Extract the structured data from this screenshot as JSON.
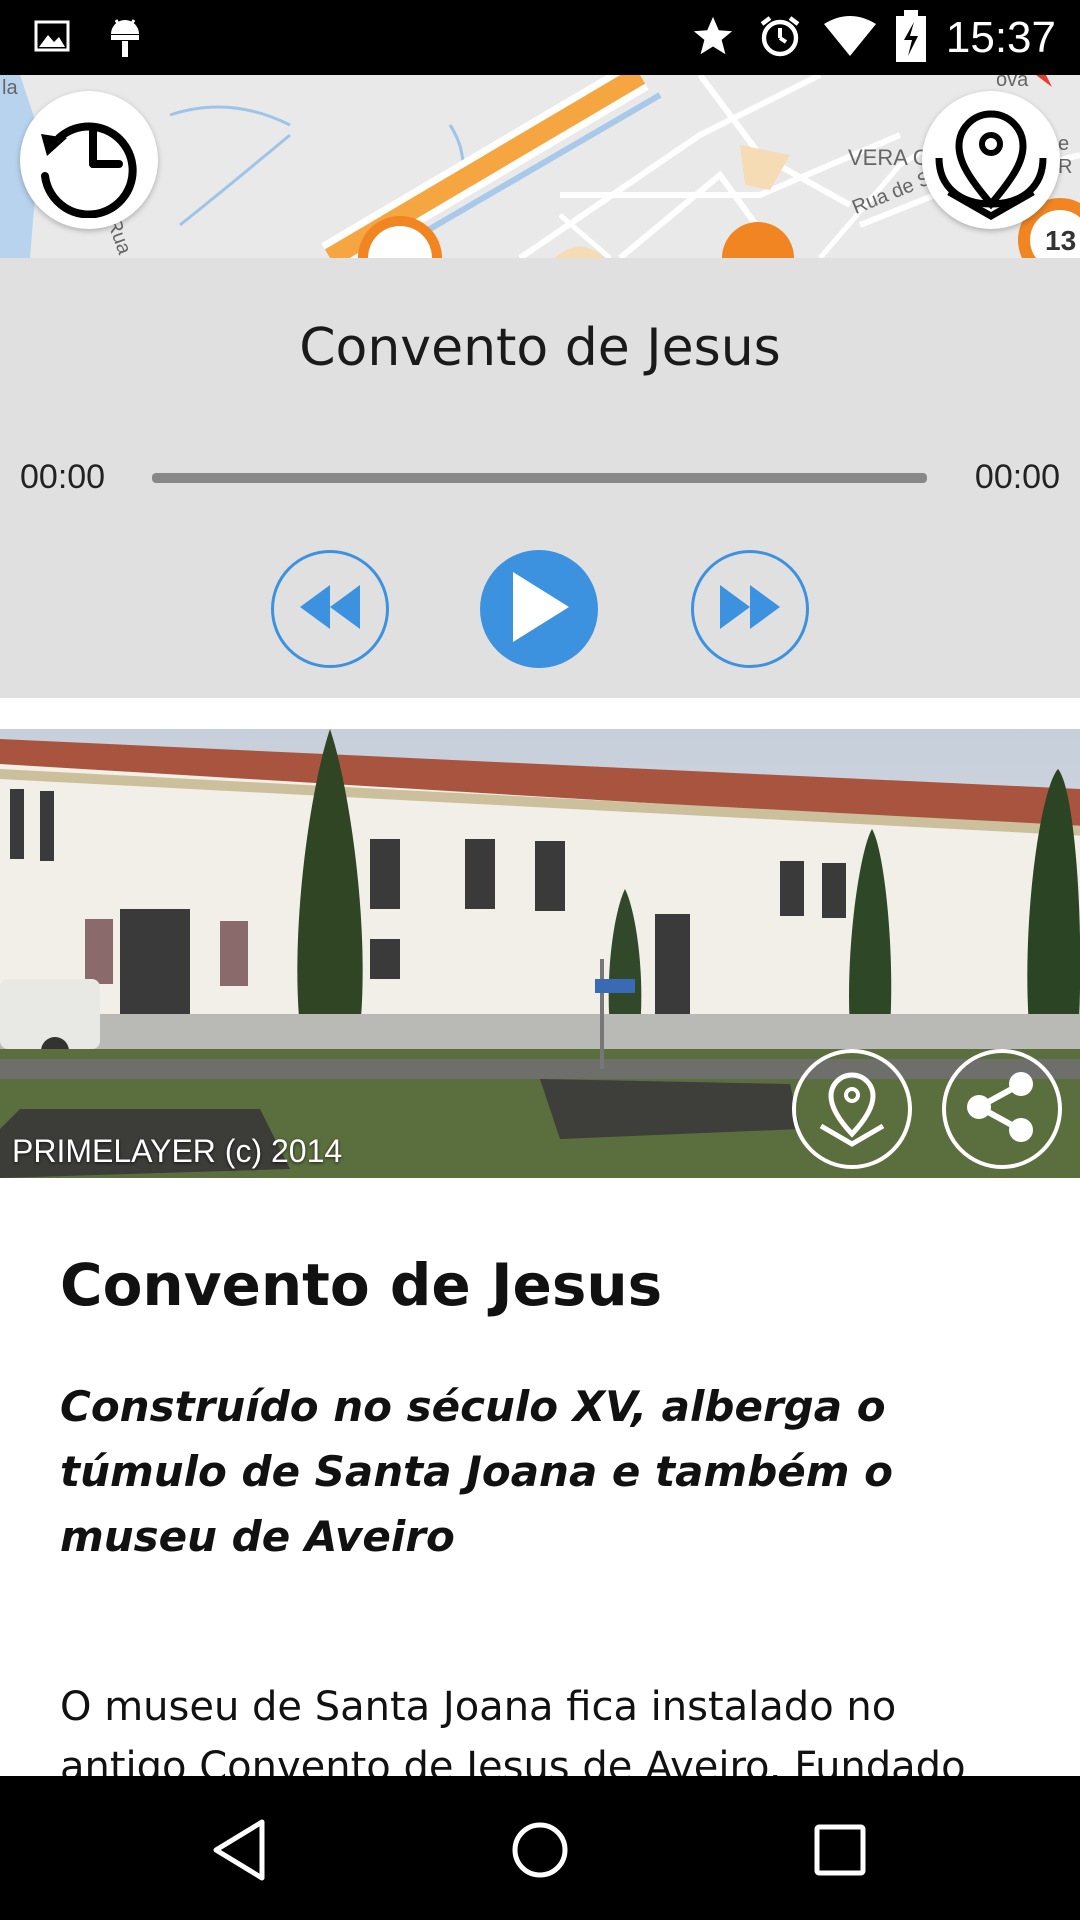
{
  "status_bar": {
    "time": "15:37",
    "left_icons": [
      "image-icon",
      "android-icon"
    ],
    "right_icons": [
      "star-icon",
      "alarm-icon",
      "wifi-icon",
      "battery-charging-icon"
    ]
  },
  "map": {
    "labels": [
      "la",
      "Rua",
      "VERA C",
      "Rua de Sá",
      "ova",
      "e R"
    ],
    "marker_numbers": [
      "13"
    ]
  },
  "player": {
    "title": "Convento de Jesus",
    "time_elapsed": "00:00",
    "time_total": "00:00",
    "progress": 0,
    "accent_color": "#3d92e0"
  },
  "photo": {
    "credit": "PRIMELAYER (c) 2014"
  },
  "article": {
    "title": "Convento de Jesus",
    "lead": "Construído no século XV, alberga o túmulo de Santa Joana e também o museu de Aveiro",
    "body": "O museu de Santa Joana fica instalado no antigo Convento de Jesus de Aveiro. Fundado"
  }
}
